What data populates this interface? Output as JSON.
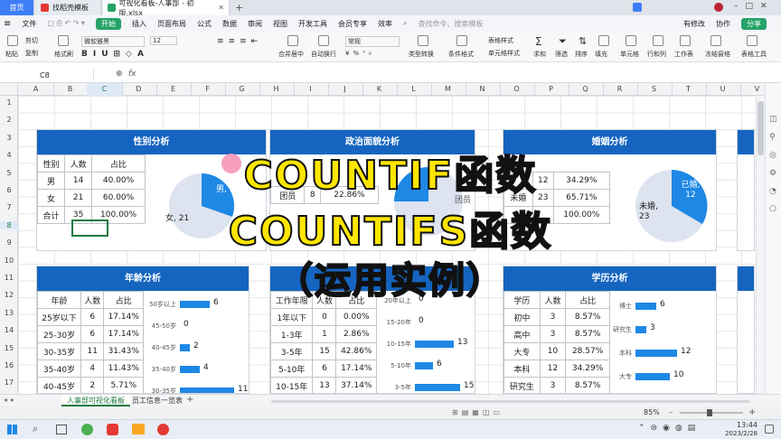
{
  "titlebar": {
    "tabs": [
      {
        "label": "首页"
      },
      {
        "label": "找稻壳模板"
      },
      {
        "label": "可视化看板-人事部 - 初版.xlsx"
      }
    ],
    "right": [
      "有修改",
      "协作",
      "分享"
    ]
  },
  "menubar": {
    "items": [
      "文件",
      "开始",
      "插入",
      "页面布局",
      "公式",
      "数据",
      "审阅",
      "视图",
      "开发工具",
      "会员专享",
      "效率"
    ],
    "search_placeholder": "查找命令、搜索模板"
  },
  "ribbon": {
    "clipboard": [
      "剪切",
      "复制",
      "格式刷",
      "粘贴"
    ],
    "font_name": "微软雅黑",
    "font_size": "12",
    "items": [
      "合并居中",
      "自动换行",
      "常规",
      "类型转换",
      "条件格式",
      "表格样式",
      "单元格样式",
      "求和",
      "筛选",
      "排序",
      "填充",
      "单元格",
      "行和列",
      "工作表",
      "冻结窗格",
      "表格工具"
    ]
  },
  "formula_bar": {
    "cell_ref": "C8",
    "fx": "fx"
  },
  "columns": [
    "A",
    "B",
    "C",
    "D",
    "E",
    "F",
    "G",
    "H",
    "I",
    "J",
    "K",
    "L",
    "M",
    "N",
    "O",
    "P",
    "Q",
    "R",
    "S",
    "T",
    "U",
    "V"
  ],
  "rows": [
    "1",
    "2",
    "3",
    "4",
    "5",
    "6",
    "7",
    "8",
    "9",
    "10",
    "11",
    "12",
    "13",
    "14",
    "15",
    "16",
    "17"
  ],
  "gender": {
    "title": "性别分析",
    "header": [
      "性别",
      "人数",
      "占比"
    ],
    "rows": [
      [
        "男",
        "14",
        "40.00%"
      ],
      [
        "女",
        "21",
        "60.00%"
      ],
      [
        "合计",
        "35",
        "100.00%"
      ]
    ],
    "pie_labels": {
      "male": "男, 14",
      "female": "女, 21"
    }
  },
  "political": {
    "title": "政治面貌分析",
    "rows": [
      [
        "团员",
        "8",
        "22.86%"
      ]
    ],
    "pie_label": "团员"
  },
  "marriage": {
    "title": "婚姻分析",
    "rows": [
      [
        "",
        "12",
        "34.29%"
      ],
      [
        "未婚",
        "23",
        "65.71%"
      ],
      [
        "",
        "",
        "100.00%"
      ]
    ],
    "pie_labels": {
      "married": "已婚, 12",
      "single": "未婚, 23"
    }
  },
  "age": {
    "title": "年龄分析",
    "header": [
      "年龄",
      "人数",
      "占比"
    ],
    "rows": [
      [
        "25岁以下",
        "6",
        "17.14%"
      ],
      [
        "25-30岁",
        "6",
        "17.14%"
      ],
      [
        "30-35岁",
        "11",
        "31.43%"
      ],
      [
        "35-40岁",
        "4",
        "11.43%"
      ],
      [
        "40-45岁",
        "2",
        "5.71%"
      ]
    ],
    "bars": [
      {
        "label": "50岁以上",
        "value": 6
      },
      {
        "label": "45-50岁",
        "value": 0
      },
      {
        "label": "40-45岁",
        "value": 2
      },
      {
        "label": "35-40岁",
        "value": 4
      },
      {
        "label": "30-35岁",
        "value": 11
      }
    ]
  },
  "tenure": {
    "header": [
      "工作年限",
      "人数",
      "占比"
    ],
    "rows": [
      [
        "1年以下",
        "0",
        "0.00%"
      ],
      [
        "1-3年",
        "1",
        "2.86%"
      ],
      [
        "3-5年",
        "15",
        "42.86%"
      ],
      [
        "5-10年",
        "6",
        "17.14%"
      ],
      [
        "10-15年",
        "13",
        "37.14%"
      ]
    ],
    "bars": [
      {
        "label": "20年以上",
        "value": 0
      },
      {
        "label": "15-20年",
        "value": 0
      },
      {
        "label": "10-15年",
        "value": 13
      },
      {
        "label": "5-10年",
        "value": 6
      },
      {
        "label": "3-5年",
        "value": 15
      }
    ]
  },
  "education": {
    "title": "学历分析",
    "header": [
      "学历",
      "人数",
      "占比"
    ],
    "rows": [
      [
        "初中",
        "3",
        "8.57%"
      ],
      [
        "高中",
        "3",
        "8.57%"
      ],
      [
        "大专",
        "10",
        "28.57%"
      ],
      [
        "本科",
        "12",
        "34.29%"
      ],
      [
        "研究生",
        "3",
        "8.57%"
      ]
    ],
    "bars": [
      {
        "label": "博士",
        "value": 6
      },
      {
        "label": "研究生",
        "value": 3
      },
      {
        "label": "本科",
        "value": 12
      },
      {
        "label": "大专",
        "value": 10
      }
    ]
  },
  "overlay": {
    "line1": "COUNTIF函数",
    "line2": "COUNTIFS函数",
    "line3": "（运用实例）"
  },
  "sheet_tabs": [
    "人事部可视化看板",
    "员工信息一览表"
  ],
  "status": {
    "zoom": "85%"
  },
  "taskbar": {
    "time": "13:44",
    "date": "2023/2/28"
  }
}
